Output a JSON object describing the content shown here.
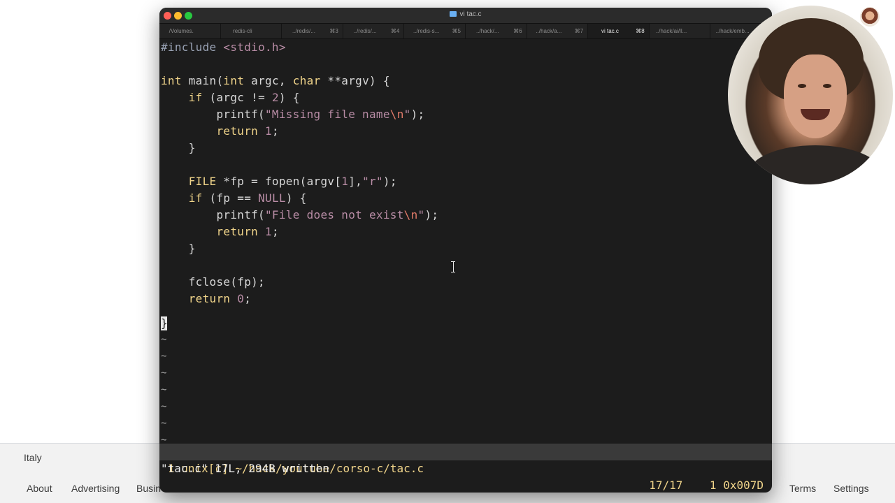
{
  "background": {
    "country": "Italy",
    "footer_links": {
      "about": "About",
      "advertising": "Advertising",
      "business": "Busin",
      "terms": "Terms",
      "settings": "Settings"
    }
  },
  "terminal": {
    "title": "vi tac.c",
    "tabs": [
      {
        "label": "/Volumes.",
        "shortcut": ""
      },
      {
        "label": "redis-cli",
        "shortcut": ""
      },
      {
        "label": "../redis/...",
        "shortcut": "⌘3"
      },
      {
        "label": "../redis/...",
        "shortcut": "⌘4"
      },
      {
        "label": "../redis-s...",
        "shortcut": "⌘5"
      },
      {
        "label": "../hack/...",
        "shortcut": "⌘6"
      },
      {
        "label": "../hack/a...",
        "shortcut": "⌘7"
      },
      {
        "label": "vi tac.c",
        "shortcut": "⌘8"
      },
      {
        "label": "../hack/ai/ll...",
        "shortcut": ""
      },
      {
        "label": "../hack/emb...",
        "shortcut": ""
      }
    ],
    "active_tab_index": 7
  },
  "editor": {
    "tilde": "~",
    "cursor_char": "}",
    "status_left": "1 unix[c] ~/hack/youtube/corso-c/tac.c",
    "status_right": "17/17    1 0x007D",
    "command_line": "\"tac.c\" 17L, 294B written"
  },
  "colors": {
    "terminal_bg": "#1c1c1c",
    "keyword": "#f0d48a",
    "string": "#b98da6",
    "escape": "#e37b6a",
    "statusline_bg": "#3a3a3a"
  }
}
